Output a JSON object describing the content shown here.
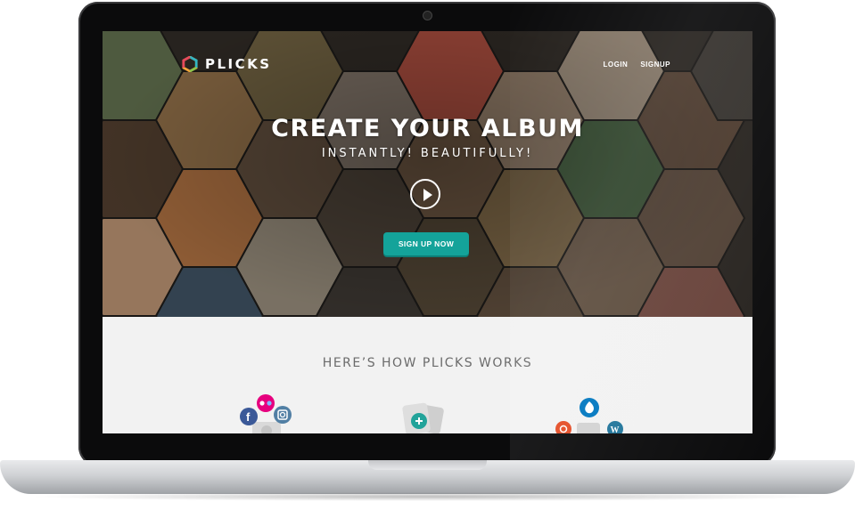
{
  "brand": {
    "name": "PLICKS"
  },
  "nav": {
    "login": "LOGIN",
    "signup": "SIGNUP"
  },
  "hero": {
    "headline": "CREATE YOUR ALBUM",
    "subline": "INSTANTLY! BEAUTIFULLY!",
    "cta_label": "SIGN UP NOW"
  },
  "how": {
    "heading": "HERE’S HOW PLICKS WORKS"
  },
  "colors": {
    "accent": "#14a39a",
    "hero_bg": "#2a2622",
    "section_bg": "#f2f2f2",
    "facebook": "#3b5998",
    "flickr": "#e6007e",
    "instagram": "#517fa4",
    "drupal": "#0077c0",
    "wordpress": "#21759b",
    "add": "#22a39a"
  },
  "icons": [
    "logo-hexagon-icon",
    "play-icon",
    "facebook-icon",
    "flickr-icon",
    "instagram-icon",
    "camera-icon",
    "add-photo-icon",
    "drupal-icon",
    "wordpress-icon",
    "joomla-icon"
  ]
}
